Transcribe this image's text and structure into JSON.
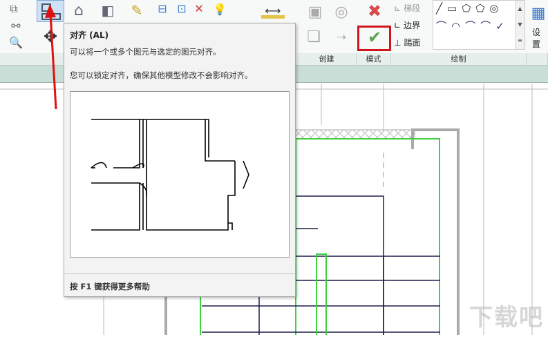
{
  "ribbon": {
    "panels": [
      {
        "label": "创建"
      },
      {
        "label": "模式"
      },
      {
        "label": "绘制"
      }
    ],
    "draw_tools": {
      "riser": "梯段",
      "boundary": "边界",
      "tread": "踢面"
    },
    "settings_label": "设置",
    "mode": {
      "cancel": "cancel-icon",
      "finish": "check-icon"
    }
  },
  "tooltip": {
    "title": "对齐 (AL)",
    "line1": "可以将一个或多个图元与选定的图元对齐。",
    "line2": "您可以锁定对齐，确保其他模型修改不会影响对齐。",
    "footer": "按 F1 键获得更多帮助"
  },
  "watermark": "下载吧",
  "colors": {
    "accent_red": "#d0161b",
    "green_line": "#3fd03f",
    "navy_line": "#1d1f4a",
    "band": "#c9ded6"
  }
}
